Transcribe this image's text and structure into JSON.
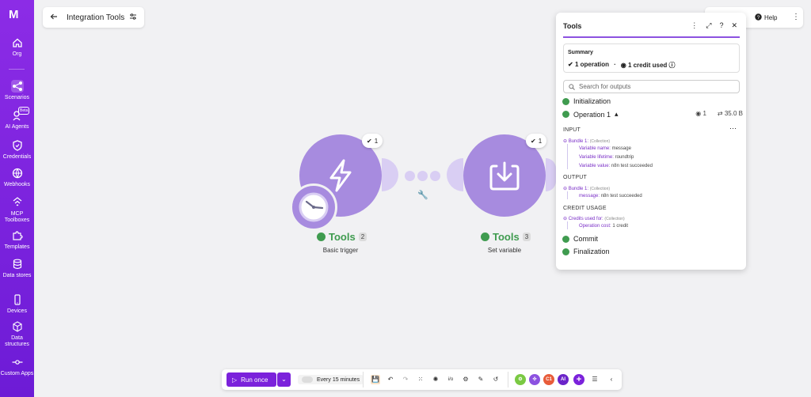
{
  "sidebar": {
    "logo": "M",
    "items": [
      {
        "label": "Org",
        "icon": "home-icon"
      },
      {
        "label": "Scenarios",
        "icon": "share-icon"
      },
      {
        "label": "AI Agents",
        "icon": "ai-agent-icon",
        "badge": "Beta"
      },
      {
        "label": "Credentials",
        "icon": "shield-icon"
      },
      {
        "label": "Webhooks",
        "icon": "globe-icon"
      },
      {
        "label": "MCP Toolboxes",
        "icon": "mcp-icon"
      },
      {
        "label": "Templates",
        "icon": "puzzle-icon"
      },
      {
        "label": "Data stores",
        "icon": "database-icon"
      },
      {
        "label": "Devices",
        "icon": "phone-icon"
      },
      {
        "label": "Data structures",
        "icon": "cube-icon"
      },
      {
        "label": "Custom Apps",
        "icon": "custom-apps-icon"
      }
    ]
  },
  "header": {
    "title": "Integration Tools"
  },
  "help": {
    "label": "Help"
  },
  "canvas": {
    "nodes": [
      {
        "name": "Tools",
        "count": "2",
        "label": "Basic trigger",
        "ops": "1"
      },
      {
        "name": "Tools",
        "count": "3",
        "label": "Set variable",
        "ops": "1"
      }
    ]
  },
  "panel": {
    "title": "Tools",
    "summary_label": "Summary",
    "operations": "1 operation",
    "credits": "1 credit used",
    "search_placeholder": "Search for outputs",
    "steps": {
      "initialization": "Initialization",
      "operation": "Operation 1",
      "commit": "Commit",
      "finalization": "Finalization"
    },
    "op_credits": "1",
    "op_size": "35.0 B",
    "input_label": "INPUT",
    "input_bundle": "Bundle 1:",
    "collection": "(Collection)",
    "input_rows": [
      {
        "k": "Variable name:",
        "v": "message"
      },
      {
        "k": "Variable lifetime:",
        "v": "roundtrip"
      },
      {
        "k": "Variable value:",
        "v": "n8n test succeeded"
      }
    ],
    "output_label": "OUTPUT",
    "output_bundle": "Bundle 1:",
    "output_rows": [
      {
        "k": "message:",
        "v": "n8n test succeeded"
      }
    ],
    "credit_label": "CREDIT USAGE",
    "credits_used_for": "Credits used for:",
    "credit_rows": [
      {
        "k": "Operation cost:",
        "v": "1 credit"
      }
    ]
  },
  "toolbar": {
    "run_label": "Run once",
    "schedule": "Every 15 minutes",
    "ai_label": "AI",
    "c1_label": "C1"
  },
  "colors": {
    "brand": "#7b22db",
    "node": "#a78bdf",
    "success": "#3f9b4f"
  }
}
